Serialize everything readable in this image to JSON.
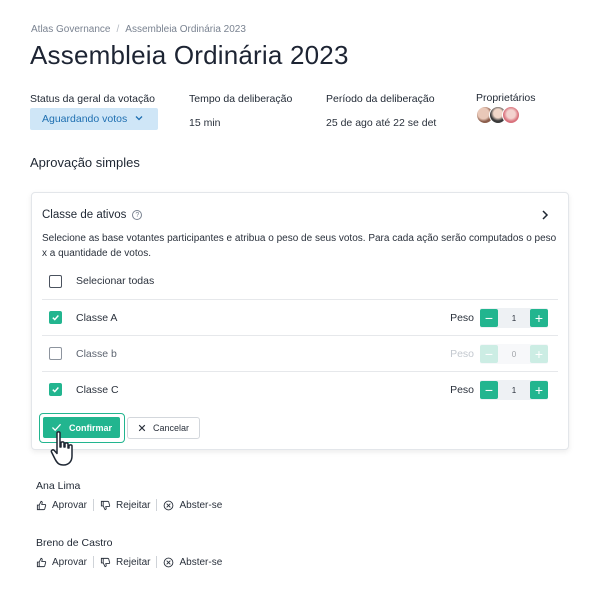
{
  "breadcrumb": [
    "Atlas Governance",
    "Assembleia Ordinária 2023"
  ],
  "page_title": "Assembleia Ordinária 2023",
  "meta": {
    "status_label": "Status da geral da votação",
    "status_value": "Aguardando votos",
    "tempo_label": "Tempo da deliberação",
    "tempo_value": "15 min",
    "periodo_label": "Período da deliberação",
    "periodo_value": "25 de ago até 22 se det",
    "proprietarios_label": "Proprietários"
  },
  "section_title": "Aprovação simples",
  "card": {
    "title": "Classe de ativos",
    "description": "Selecione as base votantes participantes e atribua o peso de seus votos. Para cada ação serão computados o peso x a quantidade de votos.",
    "select_all": "Selecionar todas",
    "weight_label": "Peso",
    "classes": [
      {
        "name": "Classe A",
        "checked": true,
        "weight": "1"
      },
      {
        "name": "Classe b",
        "checked": false,
        "weight": "0"
      },
      {
        "name": "Classe C",
        "checked": true,
        "weight": "1"
      }
    ],
    "confirm_label": "Confirmar",
    "cancel_label": "Cancelar"
  },
  "voters": [
    {
      "name": "Ana Lima",
      "approve": "Aprovar",
      "reject": "Rejeitar",
      "abstain": "Abster-se"
    },
    {
      "name": "Breno de Castro",
      "approve": "Aprovar",
      "reject": "Rejeitar",
      "abstain": "Abster-se"
    }
  ],
  "colors": {
    "accent": "#22b58f",
    "status_bg": "#cfe6f7",
    "status_text": "#1e6fb1"
  }
}
